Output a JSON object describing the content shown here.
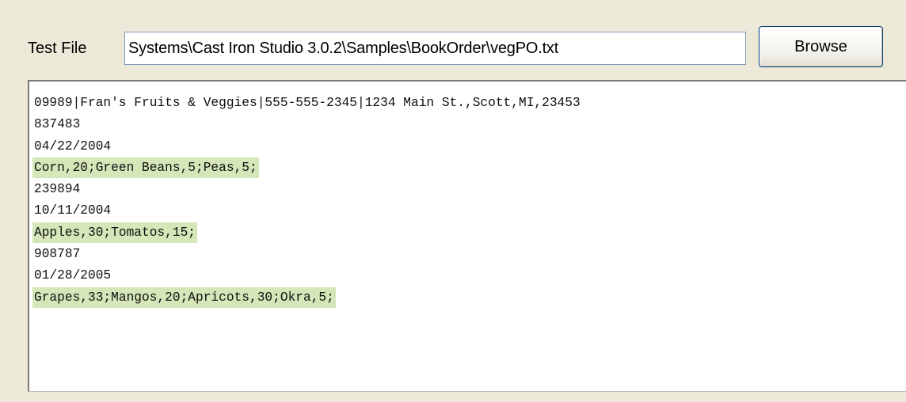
{
  "file_selector": {
    "label": "Test File",
    "path_value": "Systems\\Cast Iron Studio 3.0.2\\Samples\\BookOrder\\vegPO.txt",
    "browse_label": "Browse"
  },
  "content": {
    "highlight_color": "#D5E6B9",
    "lines": [
      {
        "text": "09989|Fran's Fruits & Veggies|555-555-2345|1234 Main St.,Scott,MI,23453",
        "highlighted": false
      },
      {
        "text": "837483",
        "highlighted": false
      },
      {
        "text": "04/22/2004",
        "highlighted": false
      },
      {
        "text": "Corn,20;Green Beans,5;Peas,5;",
        "highlighted": true
      },
      {
        "text": "239894",
        "highlighted": false
      },
      {
        "text": "10/11/2004",
        "highlighted": false
      },
      {
        "text": "Apples,30;Tomatos,15;",
        "highlighted": true
      },
      {
        "text": "908787",
        "highlighted": false
      },
      {
        "text": "01/28/2005",
        "highlighted": false
      },
      {
        "text": "Grapes,33;Mangos,20;Apricots,30;Okra,5;",
        "highlighted": true
      }
    ]
  }
}
